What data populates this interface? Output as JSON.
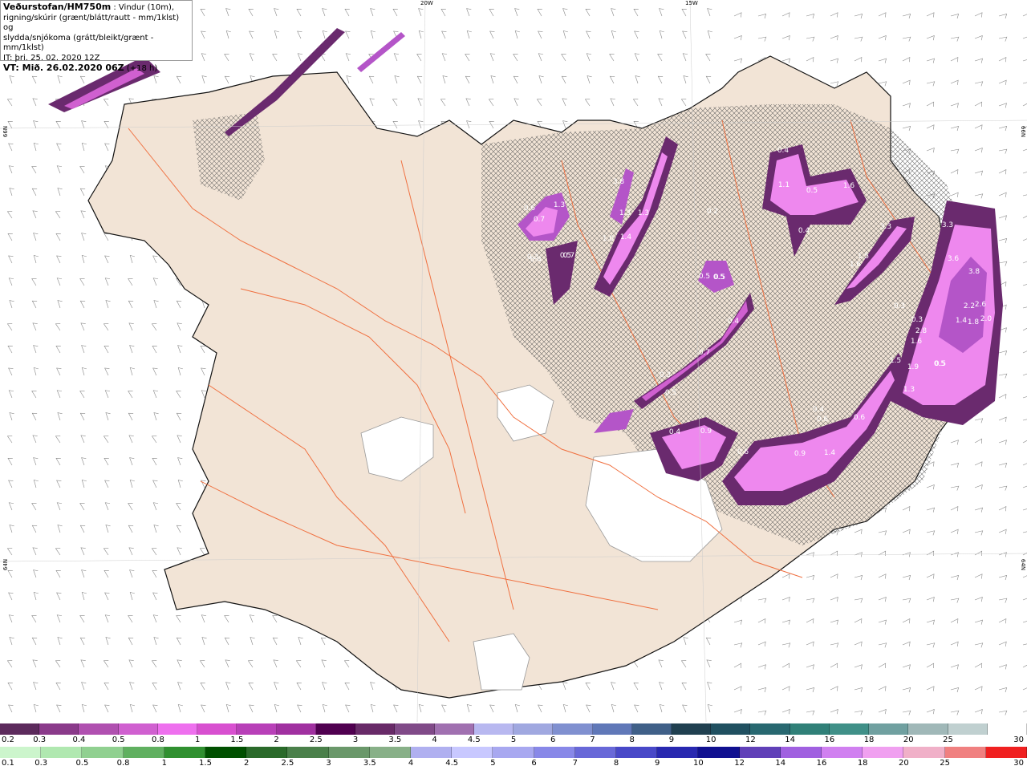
{
  "header": {
    "title": "Veðurstofan/HM750m",
    "line1_suffix": " : Vindur (10m),",
    "line2": "rigning/skúrir (grænt/blátt/rautt - mm/1klst) og",
    "line3": "slydda/snjókoma (grátt/bleikt/grænt - mm/1klst)",
    "line4": "IT: þri. 25. 02. 2020 12Z",
    "line5_label": "VT: Mið. 26.02.2020 06Z",
    "line5_suffix": " (+18 h)"
  },
  "graticule": {
    "lon_top": [
      "20W",
      "15W"
    ],
    "lat_right": [
      "66N",
      "64N"
    ],
    "lat_left": [
      "66N",
      "64N"
    ]
  },
  "precip_labels": [
    "0.6",
    "0.7",
    "1.3",
    "3.8",
    "1.3",
    "0.3",
    "0.5",
    "0.4",
    "1.1",
    "0.5",
    "1.6",
    "0.2",
    "1.0",
    "1.4",
    "0.4",
    "0.7",
    "0.5",
    "0.5",
    "0.4",
    "3.3",
    "1.5",
    "1.6",
    "3.3",
    "3.6",
    "3.8",
    "0.3",
    "2.2",
    "2.6",
    "1.4",
    "1.8",
    "2.0",
    "0.5",
    "0.3",
    "2.8",
    "1.6",
    "1.5",
    "1.9",
    "0.5",
    "1.3",
    "0.7",
    "0.3",
    "0.5",
    "0.5",
    "0.4",
    "0.9",
    "0.6",
    "0.9",
    "1.4",
    "0.6",
    "0.4",
    "0.6",
    "0.4",
    "1.3"
  ],
  "colors": {
    "land": "#f2e4d6",
    "roads": "#f07040",
    "coast": "#111111",
    "sea": "#ffffff",
    "glacier": "#ffffff",
    "hatch": "#555555",
    "precip_light": "#ee88ee",
    "precip_mid": "#b455c8",
    "precip_dark": "#6a2a6e"
  },
  "legend_snow": {
    "ticks": [
      "0.2",
      "0.3",
      "0.4",
      "0.5",
      "0.8",
      "1",
      "1.5",
      "2",
      "2.5",
      "3",
      "3.5",
      "4",
      "4.5",
      "5",
      "6",
      "7",
      "8",
      "9",
      "10",
      "12",
      "14",
      "16",
      "18",
      "20",
      "25",
      "30"
    ],
    "colors": [
      "#5c2a5c",
      "#8a3a8a",
      "#b050b0",
      "#d060d0",
      "#ee70ee",
      "#d850d0",
      "#b840b8",
      "#a030a0",
      "#500050",
      "#682a68",
      "#804a88",
      "#a070b0",
      "#b8b8f0",
      "#a0a8e0",
      "#8090d0",
      "#6078b8",
      "#406088",
      "#204050",
      "#205060",
      "#286870",
      "#308078",
      "#409088",
      "#70a0a0",
      "#a0b8b8",
      "#c0d0d0",
      "#ffffff"
    ]
  },
  "legend_rain": {
    "ticks": [
      "0.1",
      "0.3",
      "0.5",
      "0.8",
      "1",
      "1.5",
      "2",
      "2.5",
      "3",
      "3.5",
      "4",
      "4.5",
      "5",
      "6",
      "7",
      "8",
      "9",
      "10",
      "12",
      "14",
      "16",
      "18",
      "20",
      "25",
      "30"
    ],
    "colors": [
      "#ccf5cc",
      "#b0e8b0",
      "#90d090",
      "#60b060",
      "#309030",
      "#005000",
      "#2a6a2a",
      "#4a804a",
      "#6a986a",
      "#88b088",
      "#b0b0f0",
      "#c8c8ff",
      "#a8a8f0",
      "#8888e8",
      "#6868d8",
      "#4848c8",
      "#2828b0",
      "#101090",
      "#6040b8",
      "#a060e0",
      "#d080f0",
      "#f0a0f0",
      "#f0b0c8",
      "#f08080",
      "#f02020"
    ]
  }
}
